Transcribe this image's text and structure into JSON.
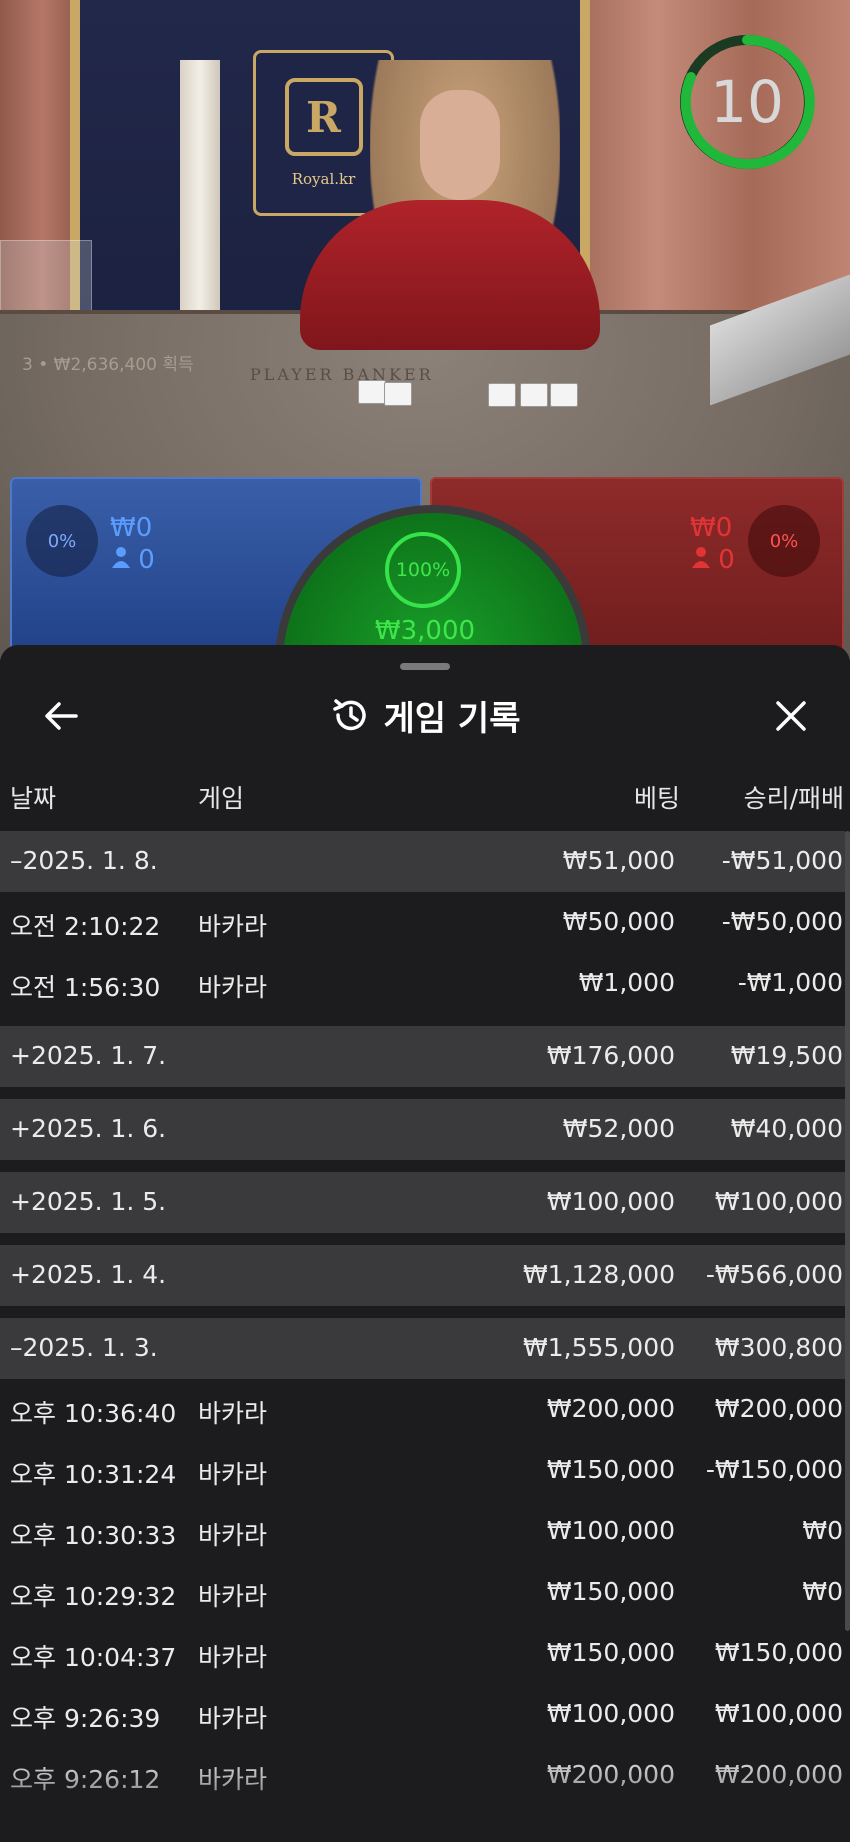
{
  "stream": {
    "plaque_label": "Royal.kr",
    "crest_letter": "R",
    "felt_text": "PLAYER  BANKER",
    "win_note": "3 • ₩2,636,400 획득",
    "timer_value": "10"
  },
  "bets": {
    "player": {
      "percent": "0%",
      "amount": "₩0",
      "players": "0"
    },
    "banker": {
      "percent": "0%",
      "amount": "₩0",
      "players": "0"
    },
    "tie": {
      "percent": "100%",
      "amount": "₩3,000"
    }
  },
  "sheet": {
    "title": "게임 기록",
    "columns": {
      "date": "날짜",
      "game": "게임",
      "bet": "베팅",
      "result": "승리/패배"
    }
  },
  "history": [
    {
      "type": "date",
      "date": "–2025. 1. 8.",
      "bet": "₩51,000",
      "result": "-₩51,000"
    },
    {
      "type": "game",
      "date": "오전 2:10:22",
      "game": "바카라",
      "bet": "₩50,000",
      "result": "-₩50,000"
    },
    {
      "type": "game",
      "date": "오전 1:56:30",
      "game": "바카라",
      "bet": "₩1,000",
      "result": "-₩1,000"
    },
    {
      "type": "date",
      "date": "+2025. 1. 7.",
      "bet": "₩176,000",
      "result": "₩19,500"
    },
    {
      "type": "date",
      "date": "+2025. 1. 6.",
      "bet": "₩52,000",
      "result": "₩40,000"
    },
    {
      "type": "date",
      "date": "+2025. 1. 5.",
      "bet": "₩100,000",
      "result": "₩100,000"
    },
    {
      "type": "date",
      "date": "+2025. 1. 4.",
      "bet": "₩1,128,000",
      "result": "-₩566,000"
    },
    {
      "type": "date",
      "date": "–2025. 1. 3.",
      "bet": "₩1,555,000",
      "result": "₩300,800"
    },
    {
      "type": "game",
      "date": "오후 10:36:40",
      "game": "바카라",
      "bet": "₩200,000",
      "result": "₩200,000"
    },
    {
      "type": "game",
      "date": "오후 10:31:24",
      "game": "바카라",
      "bet": "₩150,000",
      "result": "-₩150,000"
    },
    {
      "type": "game",
      "date": "오후 10:30:33",
      "game": "바카라",
      "bet": "₩100,000",
      "result": "₩0"
    },
    {
      "type": "game",
      "date": "오후 10:29:32",
      "game": "바카라",
      "bet": "₩150,000",
      "result": "₩0"
    },
    {
      "type": "game",
      "date": "오후 10:04:37",
      "game": "바카라",
      "bet": "₩150,000",
      "result": "₩150,000"
    },
    {
      "type": "game",
      "date": "오후 9:26:39",
      "game": "바카라",
      "bet": "₩100,000",
      "result": "₩100,000"
    },
    {
      "type": "game",
      "date": "오후 9:26:12",
      "game": "바카라",
      "bet": "₩200,000",
      "result": "₩200,000"
    }
  ],
  "icons": {
    "back": "back-arrow-icon",
    "close": "close-icon",
    "history": "history-clock-icon",
    "user": "user-icon"
  },
  "colors": {
    "player": "#5b9cff",
    "banker": "#e23434",
    "tie": "#3ee64c",
    "timer": "#1fb83a"
  }
}
